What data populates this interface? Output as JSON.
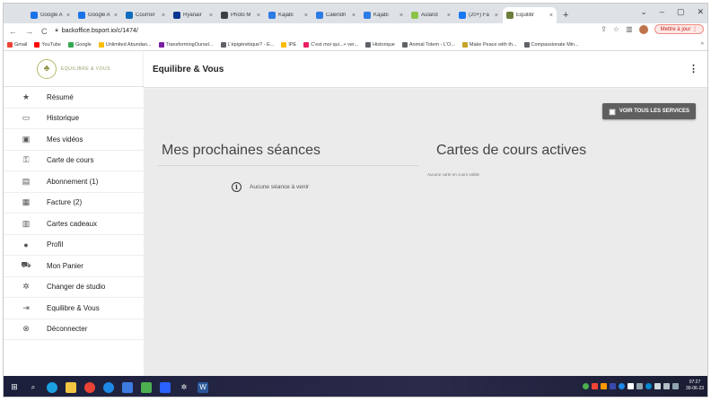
{
  "browser": {
    "tabs": [
      {
        "label": "Google A",
        "color": "#1a73e8"
      },
      {
        "label": "Google A",
        "color": "#1a73e8"
      },
      {
        "label": "Courrier",
        "color": "#0f6cbd"
      },
      {
        "label": "Ryanair",
        "color": "#073590"
      },
      {
        "label": "Photo M",
        "color": "#3c4043"
      },
      {
        "label": "Kajabi",
        "color": "#2d7be5"
      },
      {
        "label": "Calendri",
        "color": "#2d7be5"
      },
      {
        "label": "Kajabi",
        "color": "#2d7be5"
      },
      {
        "label": "Auland",
        "color": "#8bc34a"
      },
      {
        "label": "(20+) Fa",
        "color": "#1877f2"
      },
      {
        "label": "Equilibr",
        "color": "#6b7f3a"
      }
    ],
    "new_tab": "+",
    "url": "backoffice.bsport.io/c/1474/",
    "update_label": "Mettre à jour",
    "bookmarks": [
      {
        "label": "Gmail",
        "color": "#ea4335"
      },
      {
        "label": "YouTube",
        "color": "#ff0000"
      },
      {
        "label": "Google",
        "color": "#34a853"
      },
      {
        "label": "Unlimited Abundan...",
        "color": "#fbbc04"
      },
      {
        "label": "TransformingOursel...",
        "color": "#7b1fa2"
      },
      {
        "label": "L'épigénétique? - E...",
        "color": "#5f6368"
      },
      {
        "label": "IPE",
        "color": "#fbbc04"
      },
      {
        "label": "C'est moi qui...+ ver...",
        "color": "#e91e63"
      },
      {
        "label": "Historique",
        "color": "#5f6368"
      },
      {
        "label": "Animal Totem - L'O...",
        "color": "#5f6368"
      },
      {
        "label": "Make Peace with th...",
        "color": "#c9a227"
      },
      {
        "label": "Compassionate Min...",
        "color": "#5f6368"
      }
    ]
  },
  "sidebar": {
    "logo_text": "EQUILIBRE & VOUS",
    "items": [
      {
        "label": "Résumé",
        "icon": "★"
      },
      {
        "label": "Historique",
        "icon": "▭"
      },
      {
        "label": "Mes vidéos",
        "icon": "▣"
      },
      {
        "label": "Carte de cours",
        "icon": "⚿"
      },
      {
        "label": "Abonnement (1)",
        "icon": "▤"
      },
      {
        "label": "Facture (2)",
        "icon": "▦"
      },
      {
        "label": "Cartes cadeaux",
        "icon": "▥"
      },
      {
        "label": "Profil",
        "icon": "●"
      },
      {
        "label": "Mon Panier",
        "icon": "⛟"
      },
      {
        "label": "Changer de studio",
        "icon": "✲"
      },
      {
        "label": "Equilibre & Vous",
        "icon": "⇥"
      },
      {
        "label": "Déconnecter",
        "icon": "⊗"
      }
    ]
  },
  "header": {
    "title": "Equilibre & Vous"
  },
  "main": {
    "services_button": "VOIR TOUS LES SERVICES",
    "sessions_title": "Mes prochaines séances",
    "sessions_empty": "Aucune séance à venir",
    "cards_title": "Cartes de cours actives",
    "cards_empty": "Aucune carte en cours valide"
  },
  "taskbar": {
    "time": "07:27",
    "date": "30-06-23"
  }
}
